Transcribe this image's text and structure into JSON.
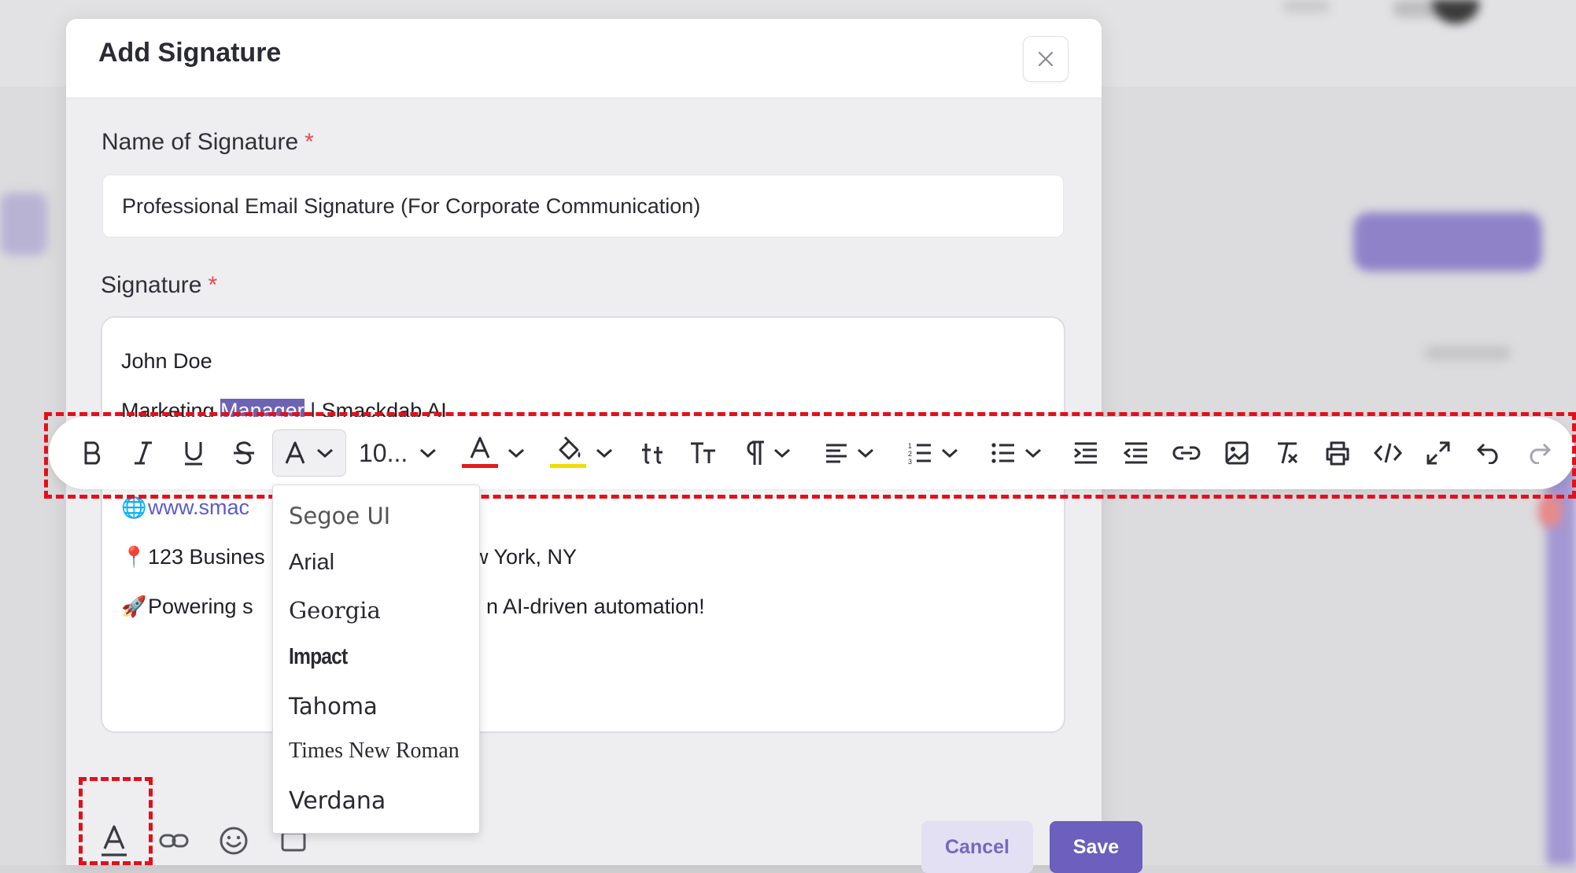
{
  "modal": {
    "title": "Add Signature"
  },
  "name_field": {
    "label": "Name of Signature",
    "required_mark": "*",
    "value": "Professional Email Signature (For Corporate Communication)"
  },
  "signature_field": {
    "label": "Signature",
    "required_mark": "*",
    "lines": {
      "name": "John Doe",
      "title_before": "Marketing ",
      "title_selected": "Manager",
      "title_after": " | Smackdab AI",
      "website_partial": "www.smac",
      "address_start": "123 Busines",
      "address_end": "w York, NY",
      "tagline_start": "Powering s",
      "tagline_end": "n AI-driven automation!"
    },
    "emojis": {
      "website": "🌐",
      "address": "📍",
      "tagline": "🚀"
    }
  },
  "toolbar": {
    "font_size": "10...",
    "text_color": "#e11b1b",
    "highlight_color": "#f2dc00",
    "buttons": [
      "bold-icon",
      "italic-icon",
      "underline-icon",
      "strikethrough-icon",
      "font-family-icon",
      "font-size",
      "text-color-icon",
      "highlight-icon",
      "lowercase-icon",
      "uppercase-icon",
      "paragraph-icon",
      "align-icon",
      "ordered-list-icon",
      "unordered-list-icon",
      "indent-icon",
      "outdent-icon",
      "link-icon",
      "image-icon",
      "clear-format-icon",
      "print-icon",
      "code-icon",
      "fullscreen-icon",
      "undo-icon",
      "redo-icon"
    ]
  },
  "font_menu": {
    "options": [
      "Segoe UI",
      "Arial",
      "Georgia",
      "Impact",
      "Tahoma",
      "Times New Roman",
      "Verdana"
    ]
  },
  "actions": {
    "cancel_label": "Cancel",
    "save_label": "Save"
  },
  "colors": {
    "accent": "#6c5fbd",
    "accent_light": "#e2e0f2",
    "required": "#e5484d",
    "annotation": "#e3101b"
  }
}
